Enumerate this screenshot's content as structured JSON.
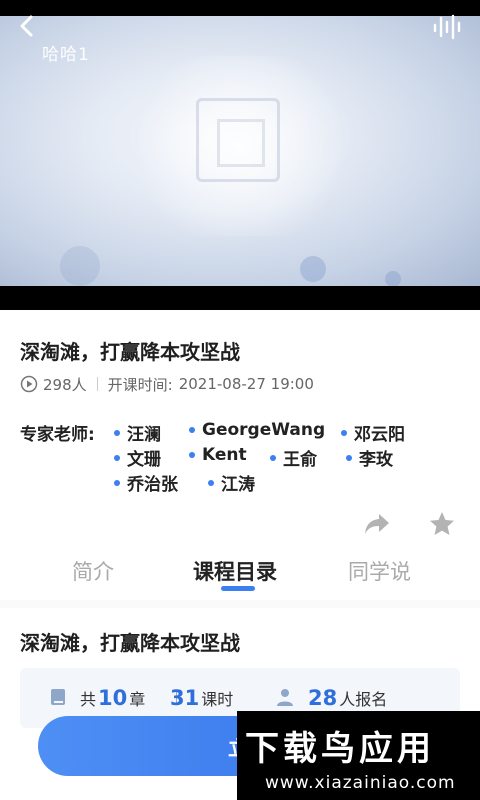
{
  "video": {
    "overlay_text": "哈哈1",
    "back_icon": "chevron-left-icon",
    "audio_icon": "audio-wave-icon"
  },
  "course": {
    "title": "深淘滩，打赢降本攻坚战",
    "views": "298人",
    "start_time_label": "开课时间:",
    "start_time": "2021-08-27 19:00"
  },
  "experts": {
    "label": "专家老师:",
    "names": [
      "汪澜",
      "GeorgeWang",
      "邓云阳",
      "文珊",
      "Kent",
      "王俞",
      "李玫",
      "乔治张",
      "江涛"
    ]
  },
  "actions": {
    "share_icon": "share-icon",
    "favorite_icon": "star-icon"
  },
  "tabs": [
    {
      "label": "简介",
      "active": false
    },
    {
      "label": "课程目录",
      "active": true
    },
    {
      "label": "同学说",
      "active": false
    }
  ],
  "catalog": {
    "title": "深淘滩，打赢降本攻坚战",
    "chapters_prefix": "共",
    "chapters_count": "10",
    "chapters_suffix": "章",
    "lessons_count": "31",
    "lessons_suffix": "课时",
    "enrolled_count": "28",
    "enrolled_suffix": "人报名"
  },
  "cta": {
    "label": "立即"
  },
  "watermark": {
    "main": "下载鸟应用",
    "url": "www.xiazainiao.com"
  },
  "colors": {
    "accent": "#3b7ff0",
    "number": "#2f6fdb"
  }
}
